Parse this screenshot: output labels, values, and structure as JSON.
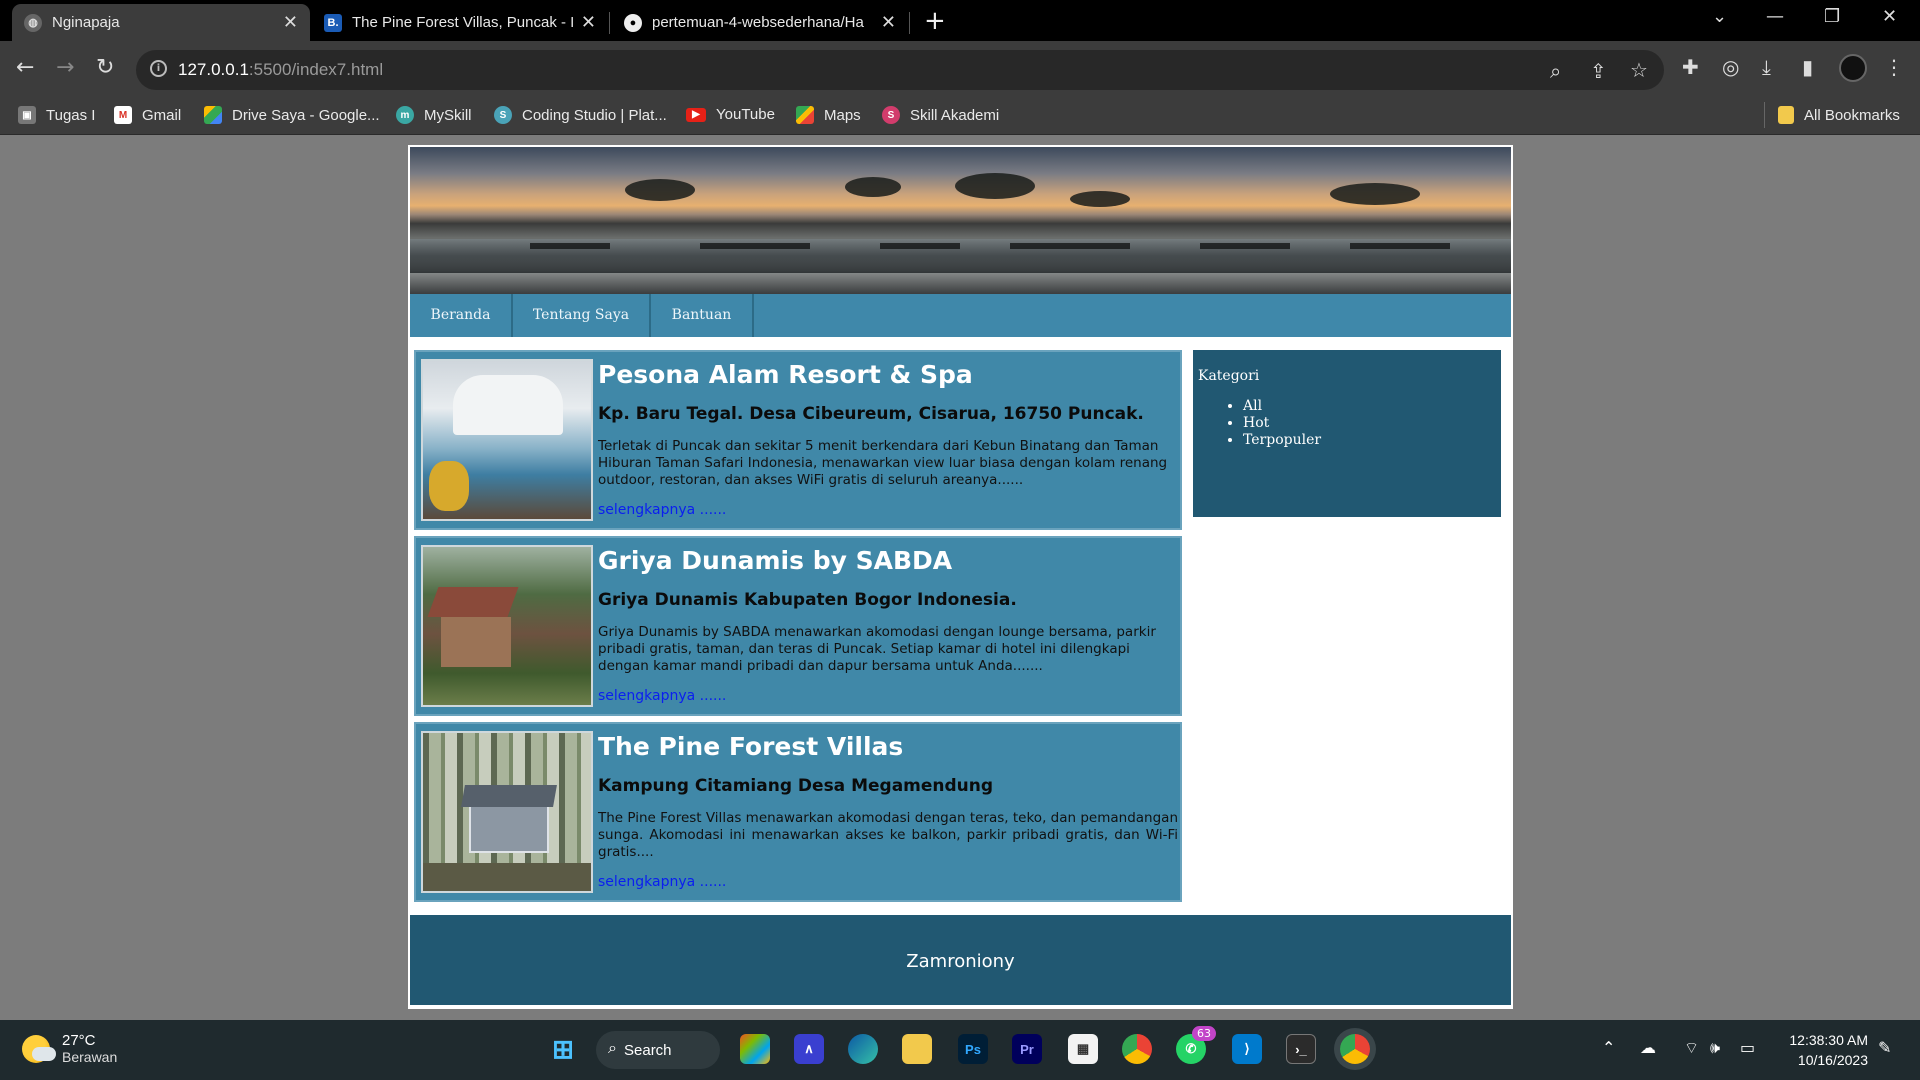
{
  "browser": {
    "tabs": [
      {
        "title": "Nginapaja",
        "active": true
      },
      {
        "title": "The Pine Forest Villas, Puncak - I",
        "icon_text": "B."
      },
      {
        "title": "pertemuan-4-websederhana/Ha"
      }
    ],
    "url_host": "127.0.0.1",
    "url_path": ":5500/index7.html",
    "bookmarks": [
      {
        "label": "Tugas I",
        "icon": "person-icon"
      },
      {
        "label": "Gmail",
        "icon": "gmail-icon"
      },
      {
        "label": "Drive Saya - Google...",
        "icon": "drive-icon"
      },
      {
        "label": "MySkill",
        "icon": "myskill-icon"
      },
      {
        "label": "Coding Studio | Plat...",
        "icon": "codingstudio-icon"
      },
      {
        "label": "YouTube",
        "icon": "youtube-icon"
      },
      {
        "label": "Maps",
        "icon": "maps-icon"
      },
      {
        "label": "Skill Akademi",
        "icon": "skillakademi-icon"
      }
    ],
    "all_bookmarks": "All Bookmarks"
  },
  "page": {
    "menu": [
      "Beranda",
      "Tentang Saya",
      "Bantuan"
    ],
    "cards": [
      {
        "title": "Pesona Alam Resort & Spa",
        "address": "Kp. Baru Tegal. Desa Cibeureum, Cisarua, 16750 Puncak.",
        "description": "Terletak di Puncak dan sekitar 5 menit berkendara dari Kebun Binatang dan Taman Hiburan Taman Safari Indonesia, menawarkan view luar biasa dengan kolam renang outdoor, restoran, dan akses WiFi gratis di seluruh areanya......",
        "more": "selengkapnya ......"
      },
      {
        "title": "Griya Dunamis by SABDA",
        "address": "Griya Dunamis Kabupaten Bogor Indonesia.",
        "description": "Griya Dunamis by SABDA menawarkan akomodasi dengan lounge bersama, parkir pribadi gratis, taman, dan teras di Puncak. Setiap kamar di hotel ini dilengkapi dengan kamar mandi pribadi dan dapur bersama untuk Anda.......",
        "more": "selengkapnya ......"
      },
      {
        "title": "The Pine Forest Villas",
        "address": "Kampung Citamiang Desa Megamendung",
        "description": "The Pine Forest Villas menawarkan akomodasi dengan teras, teko, dan pemandangan sunga. Akomodasi ini menawarkan akses ke balkon, parkir pribadi gratis, dan Wi-Fi gratis....",
        "more": "selengkapnya ......"
      }
    ],
    "sidebar": {
      "heading": "Kategori",
      "items": [
        "All",
        "Hot",
        "Terpopuler"
      ]
    },
    "footer": "Zamroniony"
  },
  "taskbar": {
    "temperature": "27°C",
    "weather": "Berawan",
    "search": "Search",
    "whatsapp_badge": "63",
    "time": "12:38:30 AM",
    "date": "10/16/2023"
  }
}
